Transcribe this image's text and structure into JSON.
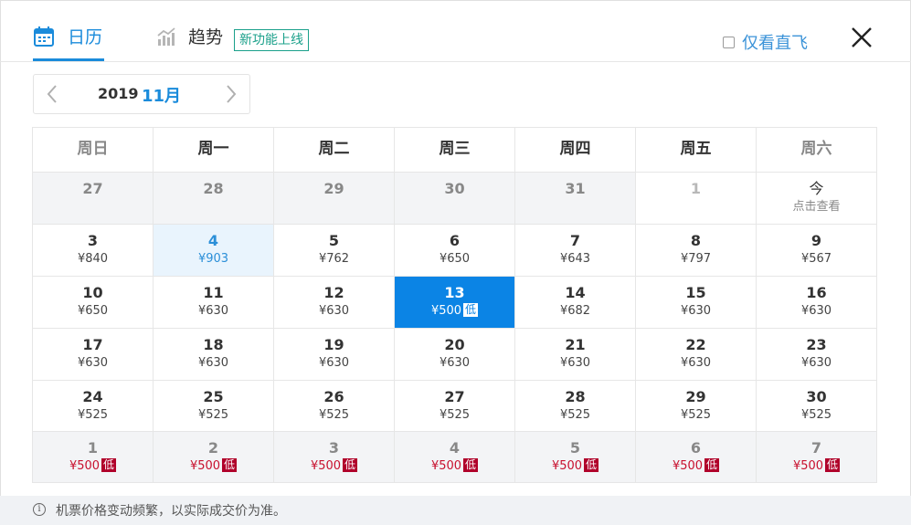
{
  "header": {
    "tabs": [
      {
        "label": "日历",
        "icon": "calendar-icon",
        "active": true
      },
      {
        "label": "趋势",
        "icon": "trend-chart-icon",
        "active": false
      }
    ],
    "new_badge": "新功能上线",
    "direct_only_label": "仅看直飞",
    "direct_only_checked": false,
    "close_icon": "close-icon"
  },
  "month_nav": {
    "year": "2019",
    "month": "11月",
    "prev_icon": "chevron-left-icon",
    "next_icon": "chevron-right-icon"
  },
  "weekdays": [
    "周日",
    "周一",
    "周二",
    "周三",
    "周四",
    "周五",
    "周六"
  ],
  "weeks": [
    [
      {
        "day": "27",
        "price": "",
        "state": "past"
      },
      {
        "day": "28",
        "price": "",
        "state": "past"
      },
      {
        "day": "29",
        "price": "",
        "state": "past"
      },
      {
        "day": "30",
        "price": "",
        "state": "past"
      },
      {
        "day": "31",
        "price": "",
        "state": "past"
      },
      {
        "day": "1",
        "price": "",
        "state": "muted"
      },
      {
        "day": "今",
        "price": "点击查看",
        "state": "today"
      }
    ],
    [
      {
        "day": "3",
        "price": "¥840"
      },
      {
        "day": "4",
        "price": "¥903",
        "state": "hover"
      },
      {
        "day": "5",
        "price": "¥762"
      },
      {
        "day": "6",
        "price": "¥650"
      },
      {
        "day": "7",
        "price": "¥643"
      },
      {
        "day": "8",
        "price": "¥797"
      },
      {
        "day": "9",
        "price": "¥567"
      }
    ],
    [
      {
        "day": "10",
        "price": "¥650"
      },
      {
        "day": "11",
        "price": "¥630"
      },
      {
        "day": "12",
        "price": "¥630"
      },
      {
        "day": "13",
        "price": "¥500",
        "state": "selected",
        "badge": "低"
      },
      {
        "day": "14",
        "price": "¥682"
      },
      {
        "day": "15",
        "price": "¥630"
      },
      {
        "day": "16",
        "price": "¥630"
      }
    ],
    [
      {
        "day": "17",
        "price": "¥630"
      },
      {
        "day": "18",
        "price": "¥630"
      },
      {
        "day": "19",
        "price": "¥630"
      },
      {
        "day": "20",
        "price": "¥630"
      },
      {
        "day": "21",
        "price": "¥630"
      },
      {
        "day": "22",
        "price": "¥630"
      },
      {
        "day": "23",
        "price": "¥630"
      }
    ],
    [
      {
        "day": "24",
        "price": "¥525"
      },
      {
        "day": "25",
        "price": "¥525"
      },
      {
        "day": "26",
        "price": "¥525"
      },
      {
        "day": "27",
        "price": "¥525"
      },
      {
        "day": "28",
        "price": "¥525"
      },
      {
        "day": "29",
        "price": "¥525"
      },
      {
        "day": "30",
        "price": "¥525"
      }
    ],
    [
      {
        "day": "1",
        "price": "¥500",
        "state": "nextmonth",
        "badge": "低"
      },
      {
        "day": "2",
        "price": "¥500",
        "state": "nextmonth",
        "badge": "低"
      },
      {
        "day": "3",
        "price": "¥500",
        "state": "nextmonth",
        "badge": "低"
      },
      {
        "day": "4",
        "price": "¥500",
        "state": "nextmonth",
        "badge": "低"
      },
      {
        "day": "5",
        "price": "¥500",
        "state": "nextmonth",
        "badge": "低"
      },
      {
        "day": "6",
        "price": "¥500",
        "state": "nextmonth",
        "badge": "低"
      },
      {
        "day": "7",
        "price": "¥500",
        "state": "nextmonth",
        "badge": "低"
      }
    ]
  ],
  "footer": {
    "info_icon": "info-icon",
    "note": "机票价格变动频繁，以实际成交价为准。"
  },
  "colors": {
    "accent": "#1a8bdb",
    "selected": "#0b84e5",
    "low_badge": "#b0002a",
    "new_badge": "#1aa08a"
  }
}
